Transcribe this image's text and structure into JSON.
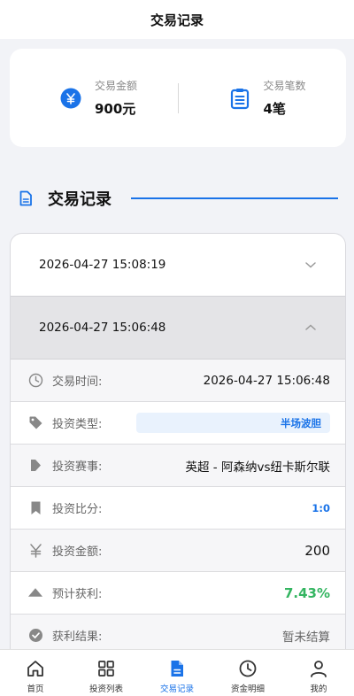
{
  "header": {
    "title": "交易记录"
  },
  "summary": {
    "amount_label": "交易金额",
    "amount_value": "900元",
    "count_label": "交易笔数",
    "count_value": "4笔",
    "amount_icon": "yen-circle-icon",
    "count_icon": "clipboard-icon"
  },
  "section": {
    "title": "交易记录",
    "icon": "document-icon"
  },
  "records": [
    {
      "time": "2026-04-27 15:08:19",
      "expanded": false
    },
    {
      "time": "2026-04-27 15:06:48",
      "expanded": true
    }
  ],
  "details": {
    "trade_time_label": "交易时间:",
    "trade_time_value": "2026-04-27 15:06:48",
    "type_label": "投资类型:",
    "type_value": "半场波胆",
    "match_label": "投资赛事:",
    "match_value": "英超 - 阿森纳vs纽卡斯尔联",
    "score_label": "投资比分:",
    "score_value": "1:0",
    "amount_label": "投资金额:",
    "amount_value": "200",
    "profit_label": "预计获利:",
    "profit_value": "7.43%",
    "result_label": "获利结果:",
    "result_value": "暂未结算"
  },
  "tabs": [
    {
      "label": "首页",
      "icon": "home-icon"
    },
    {
      "label": "投资列表",
      "icon": "grid-icon"
    },
    {
      "label": "交易记录",
      "icon": "document-icon",
      "active": true
    },
    {
      "label": "资金明细",
      "icon": "clock-icon"
    },
    {
      "label": "我的",
      "icon": "user-icon"
    }
  ],
  "colors": {
    "accent": "#1a73e8",
    "profit": "#34b561"
  }
}
